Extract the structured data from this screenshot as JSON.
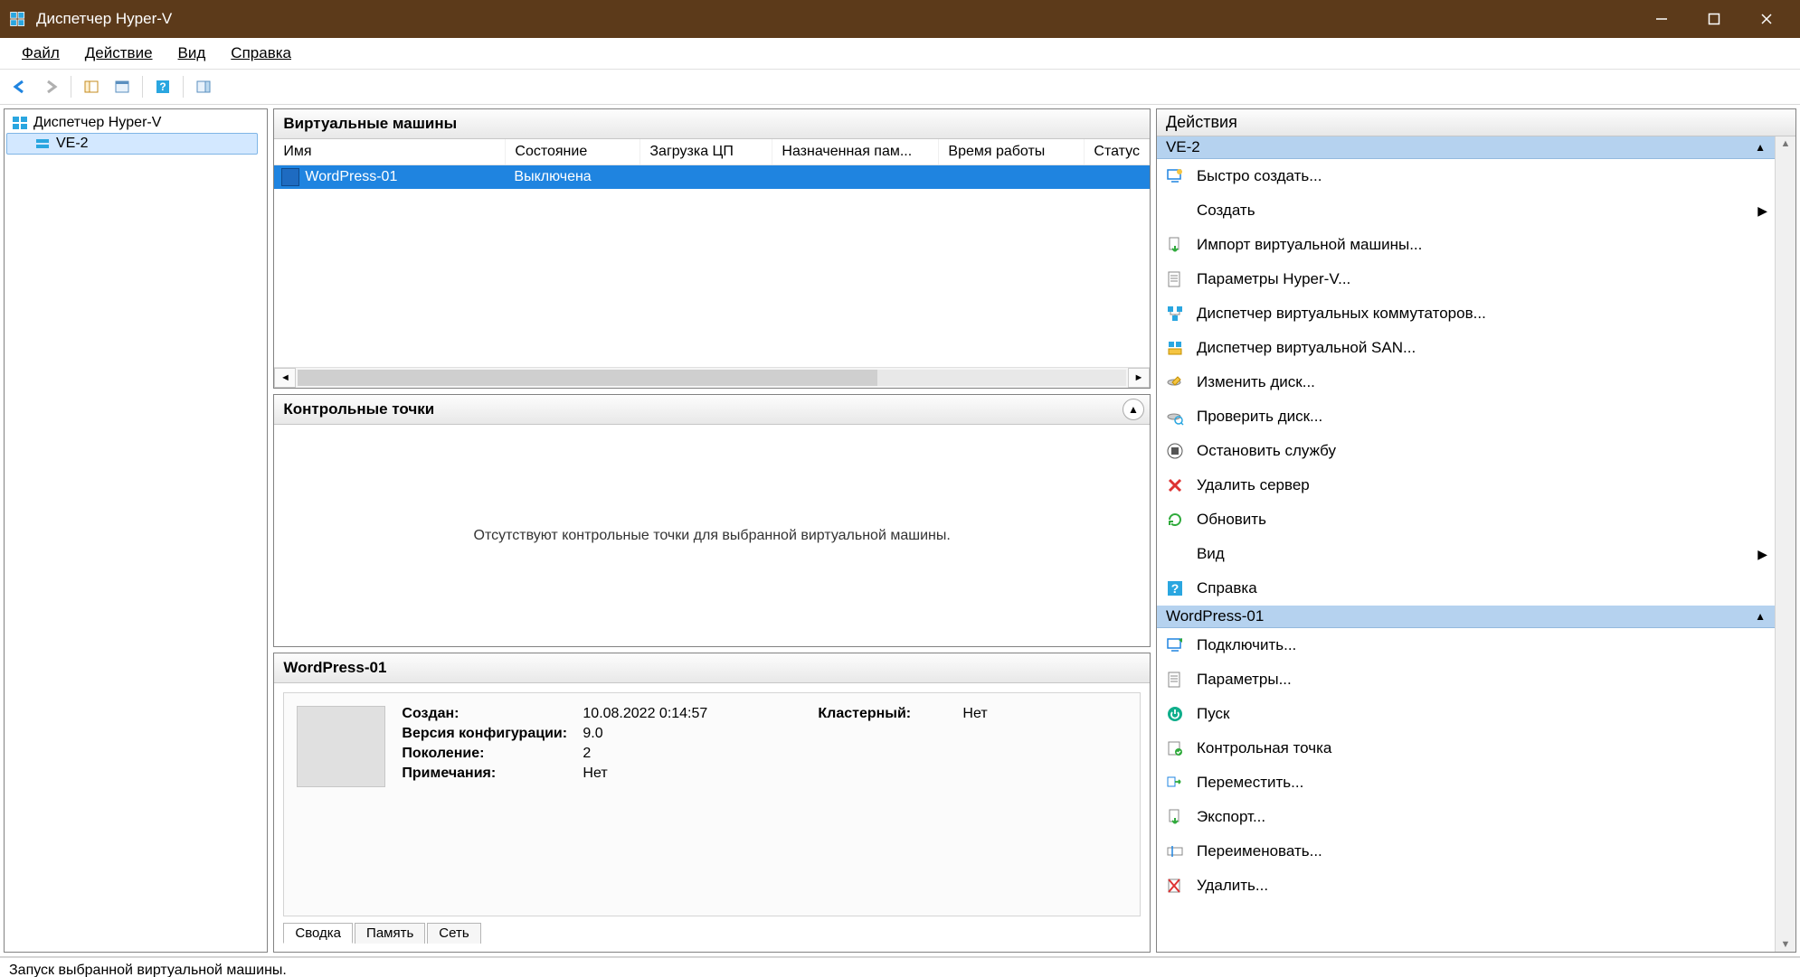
{
  "window": {
    "title": "Диспетчер Hyper-V"
  },
  "menu": {
    "file": "Файл",
    "action": "Действие",
    "view": "Вид",
    "help": "Справка"
  },
  "tree": {
    "root": "Диспетчер Hyper-V",
    "child": "VE-2"
  },
  "vm_panel": {
    "title": "Виртуальные машины",
    "cols": {
      "name": "Имя",
      "state": "Состояние",
      "cpu": "Загрузка ЦП",
      "mem": "Назначенная пам...",
      "uptime": "Время работы",
      "status": "Статус"
    },
    "rows": [
      {
        "name": "WordPress-01",
        "state": "Выключена",
        "cpu": "",
        "mem": "",
        "uptime": "",
        "status": ""
      }
    ]
  },
  "checkpoints": {
    "title": "Контрольные точки",
    "empty_msg": "Отсутствуют контрольные точки для выбранной виртуальной машины."
  },
  "details": {
    "title": "WordPress-01",
    "fields": {
      "created_lbl": "Создан:",
      "created_val": "10.08.2022 0:14:57",
      "cluster_lbl": "Кластерный:",
      "cluster_val": "Нет",
      "cfgver_lbl": "Версия конфигурации:",
      "cfgver_val": "9.0",
      "gen_lbl": "Поколение:",
      "gen_val": "2",
      "notes_lbl": "Примечания:",
      "notes_val": "Нет"
    },
    "tabs": {
      "summary": "Сводка",
      "memory": "Память",
      "network": "Сеть"
    }
  },
  "actions": {
    "header": "Действия",
    "sec1": "VE-2",
    "sec1_items": {
      "quick_create": "Быстро создать...",
      "create": "Создать",
      "import": "Импорт виртуальной машины...",
      "hv_params": "Параметры Hyper-V...",
      "vswitch": "Диспетчер виртуальных коммутаторов...",
      "vsan": "Диспетчер виртуальной SAN...",
      "edit_disk": "Изменить диск...",
      "check_disk": "Проверить диск...",
      "stop_svc": "Остановить службу",
      "del_server": "Удалить сервер",
      "refresh": "Обновить",
      "view": "Вид",
      "help": "Справка"
    },
    "sec2": "WordPress-01",
    "sec2_items": {
      "connect": "Подключить...",
      "params": "Параметры...",
      "start": "Пуск",
      "checkpoint": "Контрольная точка",
      "move": "Переместить...",
      "export": "Экспорт...",
      "rename": "Переименовать...",
      "delete": "Удалить..."
    }
  },
  "status": "Запуск выбранной виртуальной машины."
}
